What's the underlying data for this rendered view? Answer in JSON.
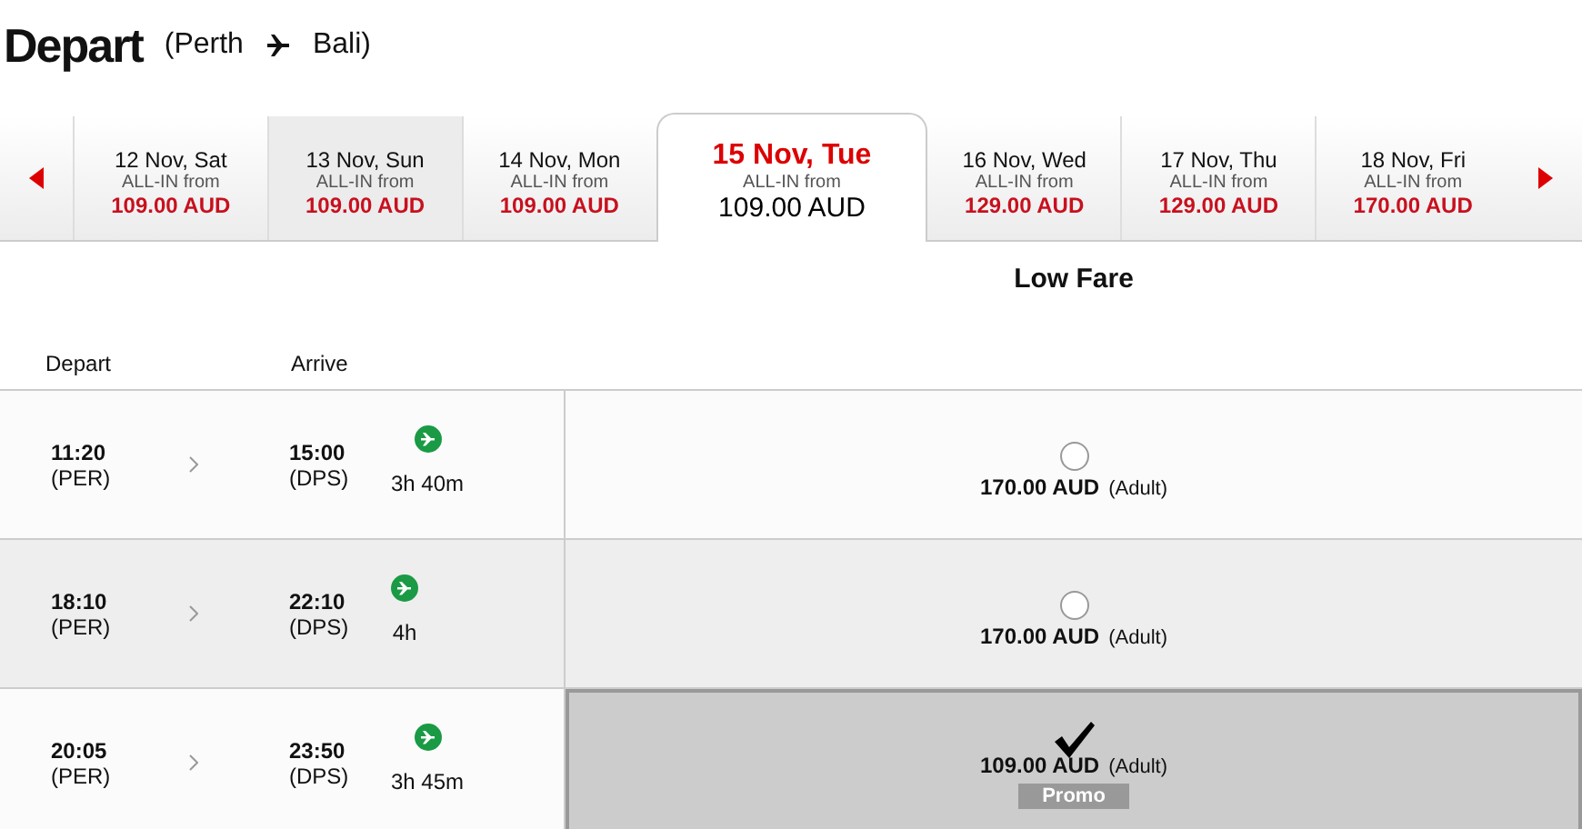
{
  "heading": {
    "title": "Depart",
    "route_from": "(Perth",
    "route_to": "Bali)"
  },
  "dates": [
    {
      "date": "12 Nov, Sat",
      "caption": "ALL-IN from",
      "price": "109.00 AUD",
      "selected": false,
      "hovered": false
    },
    {
      "date": "13 Nov, Sun",
      "caption": "ALL-IN from",
      "price": "109.00 AUD",
      "selected": false,
      "hovered": true
    },
    {
      "date": "14 Nov, Mon",
      "caption": "ALL-IN from",
      "price": "109.00 AUD",
      "selected": false,
      "hovered": false
    },
    {
      "date": "15 Nov, Tue",
      "caption": "ALL-IN from",
      "price": "109.00 AUD",
      "selected": true,
      "hovered": false
    },
    {
      "date": "16 Nov, Wed",
      "caption": "ALL-IN from",
      "price": "129.00 AUD",
      "selected": false,
      "hovered": false
    },
    {
      "date": "17 Nov, Thu",
      "caption": "ALL-IN from",
      "price": "129.00 AUD",
      "selected": false,
      "hovered": false
    },
    {
      "date": "18 Nov, Fri",
      "caption": "ALL-IN from",
      "price": "170.00 AUD",
      "selected": false,
      "hovered": false
    }
  ],
  "table": {
    "fare_heading": "Low Fare",
    "columns": [
      "Depart",
      "Arrive"
    ],
    "rows": [
      {
        "depart_time": "11:20",
        "depart_code": "(PER)",
        "arrive_time": "15:00",
        "arrive_code": "(DPS)",
        "duration": "3h 40m",
        "fare": "170.00 AUD",
        "passenger": "(Adult)",
        "selected": false
      },
      {
        "depart_time": "18:10",
        "depart_code": "(PER)",
        "arrive_time": "22:10",
        "arrive_code": "(DPS)",
        "duration": "4h",
        "fare": "170.00 AUD",
        "passenger": "(Adult)",
        "selected": false
      },
      {
        "depart_time": "20:05",
        "depart_code": "(PER)",
        "arrive_time": "23:50",
        "arrive_code": "(DPS)",
        "duration": "3h 45m",
        "fare": "109.00 AUD",
        "passenger": "(Adult)",
        "selected": true,
        "badge": "Promo"
      }
    ]
  }
}
